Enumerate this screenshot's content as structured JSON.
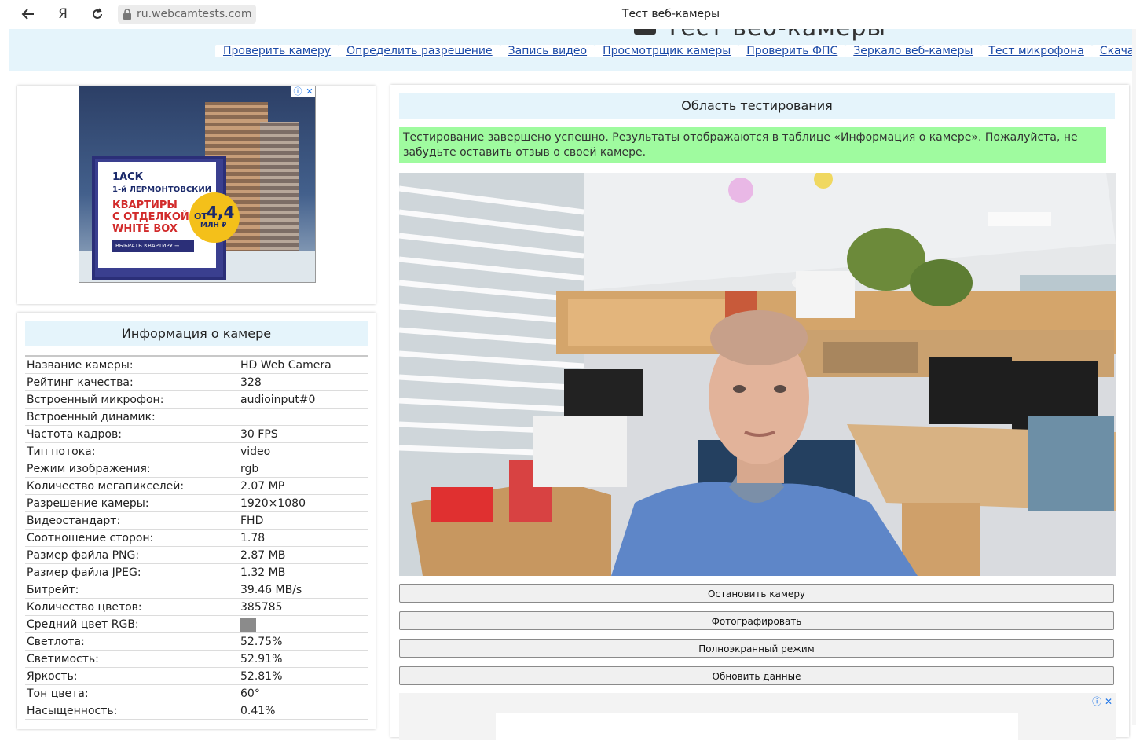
{
  "browser": {
    "url": "ru.webcamtests.com",
    "tab_title": "Тест веб-камеры",
    "yandex_label": "Я"
  },
  "header": {
    "logo_text": "Тест веб-камеры",
    "nav": [
      "Проверить камеру",
      "Определить разрешение",
      "Запись видео",
      "Просмотрщик камеры",
      "Проверить ФПС",
      "Зеркало веб-камеры",
      "Тест микрофона",
      "Скачать др"
    ]
  },
  "ad": {
    "logo": "1АСК",
    "complex": "1-й ЛЕРМОНТОВСКИЙ",
    "headline_1": "КВАРТИРЫ",
    "headline_2": "С ОТДЕЛКОЙ",
    "headline_3": "WHITE BOX",
    "button": "ВЫБРАТЬ КВАРТИРУ →",
    "price_prefix": "ОТ",
    "price": "4,4",
    "price_unit": "МЛН ₽",
    "info_icon": "ⓘ",
    "close_icon": "✕"
  },
  "camera_info": {
    "title": "Информация о камере",
    "rows": [
      {
        "k": "Название камеры:",
        "v": "HD Web Camera"
      },
      {
        "k": "Рейтинг качества:",
        "v": "328"
      },
      {
        "k": "Встроенный микрофон:",
        "v": "audioinput#0"
      },
      {
        "k": "Встроенный динамик:",
        "v": ""
      },
      {
        "k": "Частота кадров:",
        "v": "30 FPS"
      },
      {
        "k": "Тип потока:",
        "v": "video"
      },
      {
        "k": "Режим изображения:",
        "v": "rgb"
      },
      {
        "k": "Количество мегапикселей:",
        "v": "2.07 MP"
      },
      {
        "k": "Разрешение камеры:",
        "v": "1920×1080"
      },
      {
        "k": "Видеостандарт:",
        "v": "FHD"
      },
      {
        "k": "Соотношение сторон:",
        "v": "1.78"
      },
      {
        "k": "Размер файла PNG:",
        "v": "2.87 MB"
      },
      {
        "k": "Размер файла JPEG:",
        "v": "1.32 MB"
      },
      {
        "k": "Битрейт:",
        "v": "39.46 MB/s"
      },
      {
        "k": "Количество цветов:",
        "v": "385785"
      },
      {
        "k": "Средний цвет RGB:",
        "v": ""
      },
      {
        "k": "Светлота:",
        "v": "52.75%"
      },
      {
        "k": "Светимость:",
        "v": "52.91%"
      },
      {
        "k": "Яркость:",
        "v": "52.81%"
      },
      {
        "k": "Тон цвета:",
        "v": "60°"
      },
      {
        "k": "Насыщенность:",
        "v": "0.41%"
      }
    ],
    "avg_color": "#8b8b8b"
  },
  "test_area": {
    "title": "Область тестирования",
    "success_message": "Тестирование завершено успешно. Результаты отображаются в таблице «Информация о камере». Пожалуйста, не забудьте оставить отзыв о своей камере.",
    "buttons": {
      "stop": "Остановить камеру",
      "photo": "Фотографировать",
      "fullscreen": "Полноэкранный режим",
      "refresh": "Обновить данные"
    }
  },
  "bottom_ad": {
    "info_icon": "ⓘ",
    "close_icon": "✕"
  },
  "colors": {
    "header_bg": "#e5f4fb",
    "link": "#1a4aa8",
    "success_bg": "#9ffb9f"
  }
}
